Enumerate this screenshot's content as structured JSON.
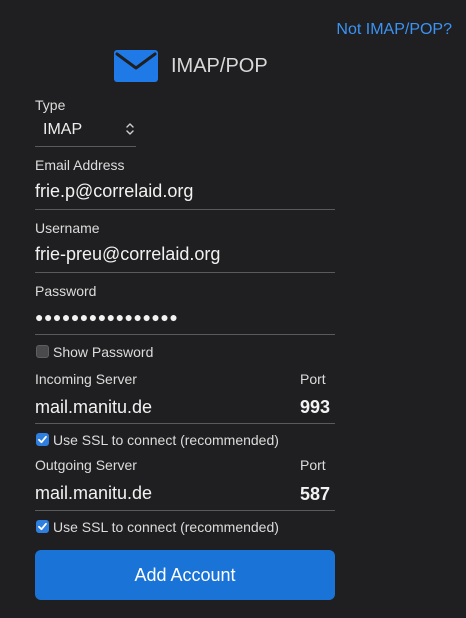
{
  "header": {
    "link": "Not IMAP/POP?",
    "icon": "mail-envelope-icon",
    "title": "IMAP/POP"
  },
  "form": {
    "type": {
      "label": "Type",
      "value": "IMAP"
    },
    "email": {
      "label": "Email Address",
      "value": "frie.p@correlaid.org"
    },
    "username": {
      "label": "Username",
      "value": "frie-preu@correlaid.org"
    },
    "password": {
      "label": "Password",
      "value": "●●●●●●●●●●●●●●●●"
    },
    "show_password": {
      "label": "Show Password",
      "checked": false
    },
    "incoming": {
      "label": "Incoming Server",
      "value": "mail.manitu.de",
      "port_label": "Port",
      "port": "993",
      "ssl_label": "Use SSL to connect (recommended)",
      "ssl_checked": true
    },
    "outgoing": {
      "label": "Outgoing Server",
      "value": "mail.manitu.de",
      "port_label": "Port",
      "port": "587",
      "ssl_label": "Use SSL to connect (recommended)",
      "ssl_checked": true
    },
    "submit_label": "Add Account"
  },
  "colors": {
    "background": "#1f1f21",
    "accent": "#1a73d6",
    "link": "#3a93f5"
  }
}
